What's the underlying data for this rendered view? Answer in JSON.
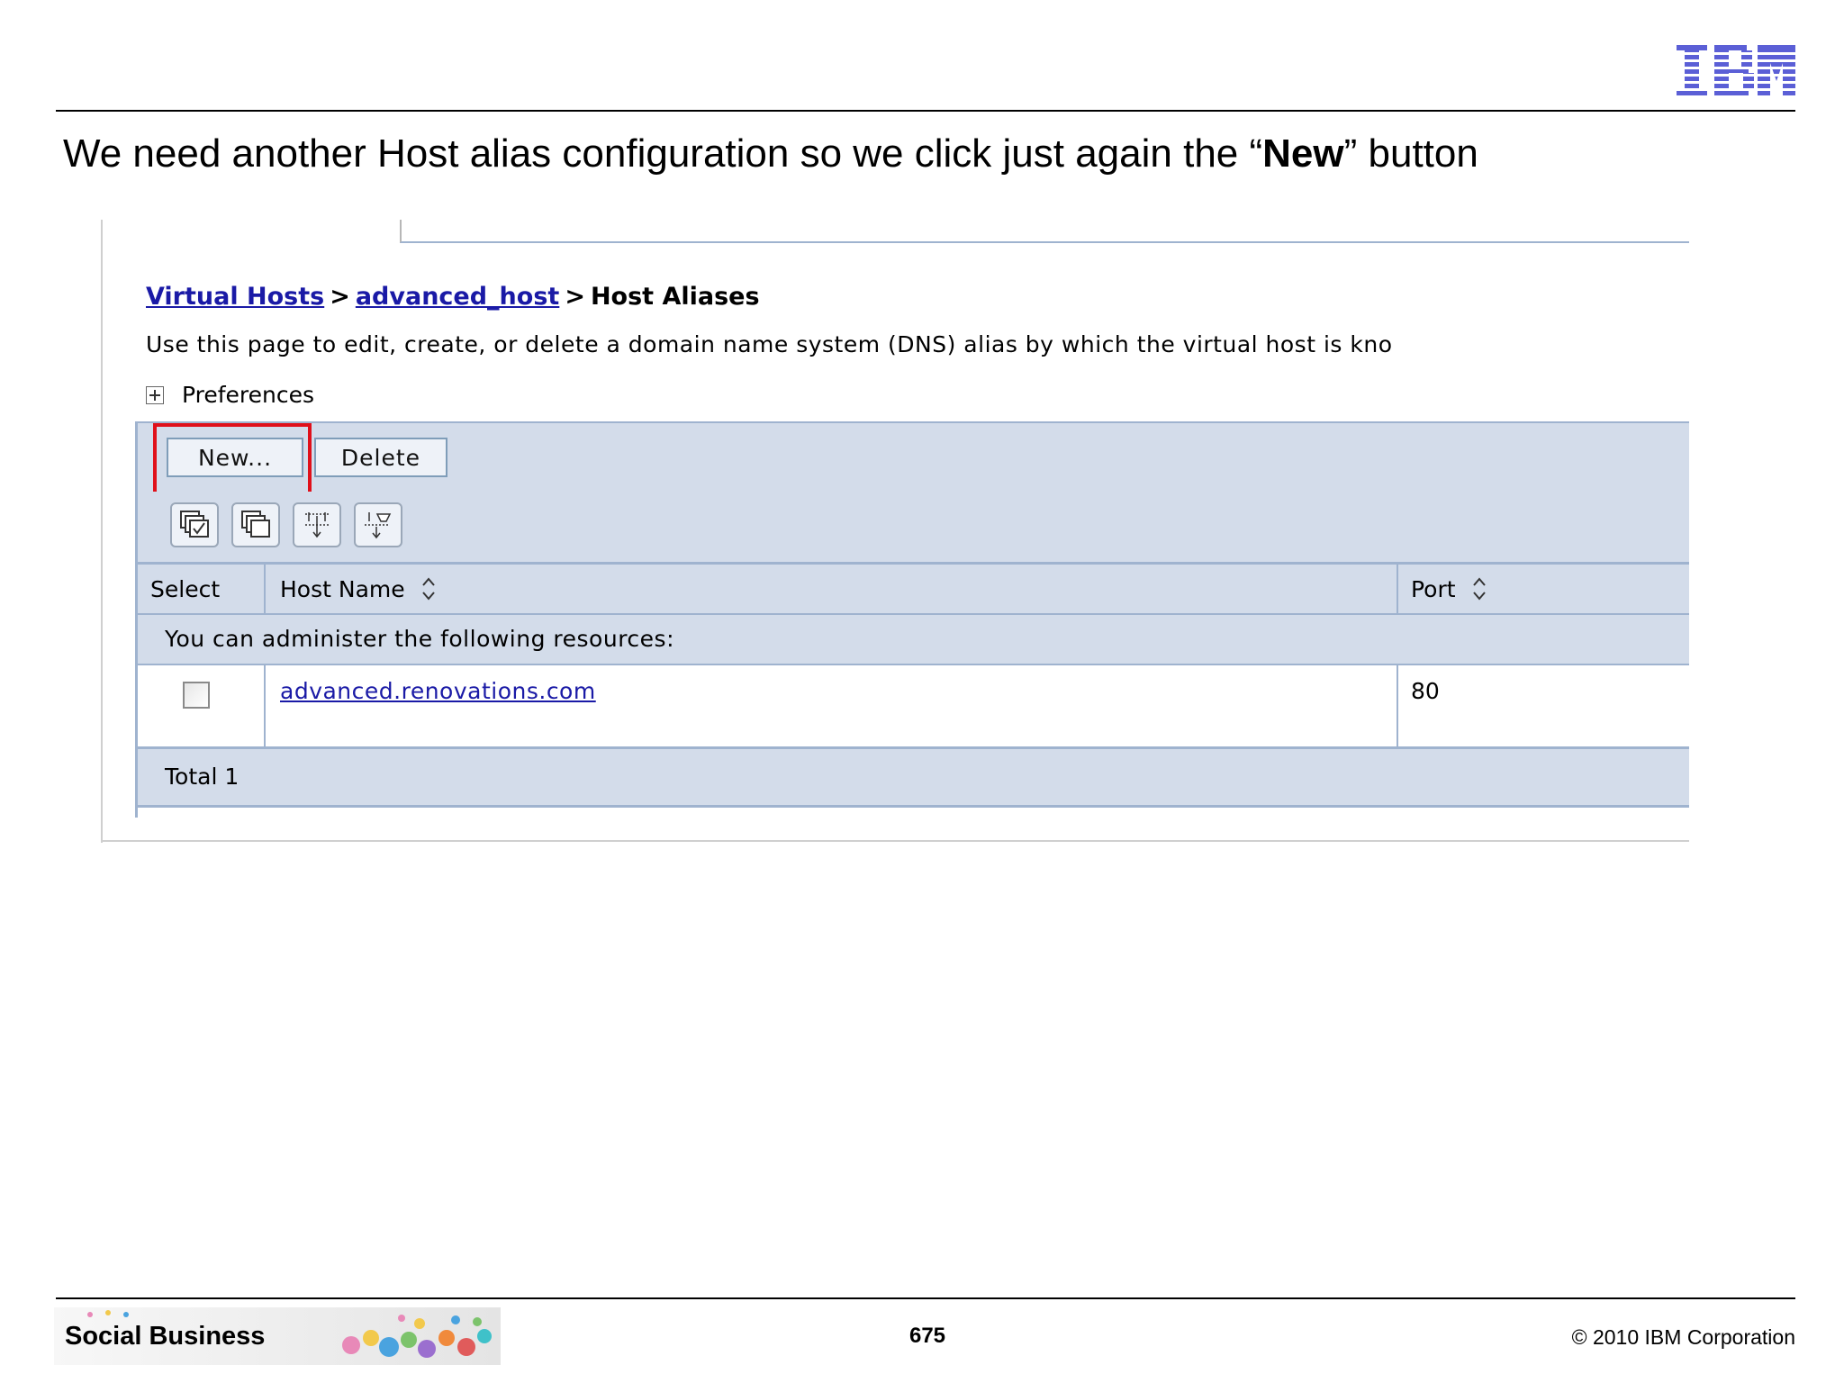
{
  "slide": {
    "title_prefix": "We need another Host alias configuration so we click just again the “",
    "title_bold": "New",
    "title_suffix": "” button",
    "page_number": "675",
    "copyright": "© 2010 IBM Corporation",
    "footer_brand": "Social Business",
    "logo_text": "IBM"
  },
  "console": {
    "breadcrumb": {
      "link1": "Virtual Hosts",
      "link2": "advanced_host",
      "separator": ">",
      "current": "Host Aliases"
    },
    "description": "Use this page to edit, create, or delete a domain name system (DNS) alias by which the virtual host is kno",
    "preferences_label": "Preferences",
    "buttons": {
      "new_label": "New...",
      "delete_label": "Delete"
    },
    "icons": [
      "select-all-icon",
      "deselect-all-icon",
      "show-filter-icon",
      "clear-filter-icon"
    ],
    "table": {
      "columns": [
        "Select",
        "Host Name",
        "Port"
      ],
      "message": "You can administer the following resources:",
      "rows": [
        {
          "host_name": "advanced.renovations.com",
          "port": "80"
        }
      ],
      "total": "Total 1"
    }
  },
  "colors": {
    "panel_bg": "#d3dcea",
    "panel_border": "#9fb3cf",
    "link": "#1a1aa6",
    "highlight": "#e0101a",
    "ibm_logo": "#5b5fd6"
  }
}
